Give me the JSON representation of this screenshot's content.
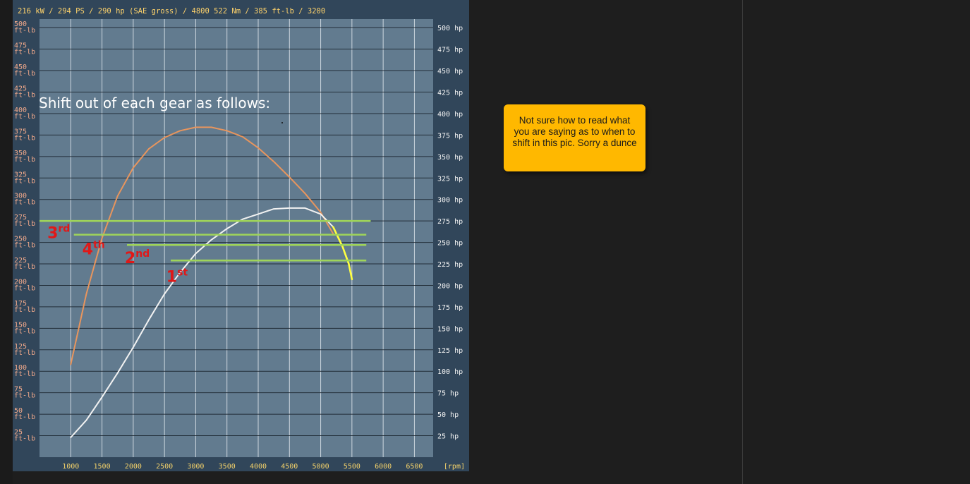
{
  "chart_data": {
    "type": "line",
    "title": "216 kW / 294 PS / 290 hp  (SAE gross) / 4800 522 Nm / 385 ft-lb / 3200",
    "xunit": "[rpm]",
    "x_ticks": [
      "1000",
      "1500",
      "2000",
      "2500",
      "3000",
      "3500",
      "4000",
      "4500",
      "5000",
      "5500",
      "6000",
      "6500"
    ],
    "xlim": [
      500,
      6800
    ],
    "ylim": [
      0,
      510
    ],
    "left_ticks": [
      {
        "v": 500,
        "a": "500",
        "b": "ft-lb"
      },
      {
        "v": 475,
        "a": "475",
        "b": "ft-lb"
      },
      {
        "v": 450,
        "a": "450",
        "b": "ft-lb"
      },
      {
        "v": 425,
        "a": "425",
        "b": "ft-lb"
      },
      {
        "v": 400,
        "a": "400",
        "b": "ft-lb"
      },
      {
        "v": 375,
        "a": "375",
        "b": "ft-lb"
      },
      {
        "v": 350,
        "a": "350",
        "b": "ft-lb"
      },
      {
        "v": 325,
        "a": "325",
        "b": "ft-lb"
      },
      {
        "v": 300,
        "a": "300",
        "b": "ft-lb"
      },
      {
        "v": 275,
        "a": "275",
        "b": "ft-lb"
      },
      {
        "v": 250,
        "a": "250",
        "b": "ft-lb"
      },
      {
        "v": 225,
        "a": "225",
        "b": "ft-lb"
      },
      {
        "v": 200,
        "a": "200",
        "b": "ft-lb"
      },
      {
        "v": 175,
        "a": "175",
        "b": "ft-lb"
      },
      {
        "v": 150,
        "a": "150",
        "b": "ft-lb"
      },
      {
        "v": 125,
        "a": "125",
        "b": "ft-lb"
      },
      {
        "v": 100,
        "a": "100",
        "b": "ft-lb"
      },
      {
        "v": 75,
        "a": "75",
        "b": "ft-lb"
      },
      {
        "v": 50,
        "a": "50",
        "b": "ft-lb"
      },
      {
        "v": 25,
        "a": "25",
        "b": "ft-lb"
      }
    ],
    "right_ticks": [
      {
        "v": 500,
        "t": "500 hp"
      },
      {
        "v": 475,
        "t": "475 hp"
      },
      {
        "v": 450,
        "t": "450 hp"
      },
      {
        "v": 425,
        "t": "425 hp"
      },
      {
        "v": 400,
        "t": "400 hp"
      },
      {
        "v": 375,
        "t": "375 hp"
      },
      {
        "v": 350,
        "t": "350 hp"
      },
      {
        "v": 325,
        "t": "325 hp"
      },
      {
        "v": 300,
        "t": "300 hp"
      },
      {
        "v": 275,
        "t": "275 hp"
      },
      {
        "v": 250,
        "t": "250 hp"
      },
      {
        "v": 225,
        "t": "225 hp"
      },
      {
        "v": 200,
        "t": "200 hp"
      },
      {
        "v": 175,
        "t": "175 hp"
      },
      {
        "v": 150,
        "t": "150 hp"
      },
      {
        "v": 125,
        "t": "125 hp"
      },
      {
        "v": 100,
        "t": "100 hp"
      },
      {
        "v": 75,
        "t": "75 hp"
      },
      {
        "v": 50,
        "t": "50 hp"
      },
      {
        "v": 25,
        "t": "25 hp"
      }
    ],
    "series": [
      {
        "color": "#e8955d",
        "points": [
          [
            1000,
            108
          ],
          [
            1250,
            190
          ],
          [
            1500,
            255
          ],
          [
            1750,
            304
          ],
          [
            2000,
            337
          ],
          [
            2250,
            359
          ],
          [
            2500,
            372
          ],
          [
            2750,
            380
          ],
          [
            3000,
            384
          ],
          [
            3250,
            384
          ],
          [
            3500,
            380
          ],
          [
            3750,
            373
          ],
          [
            4000,
            360
          ],
          [
            4250,
            344
          ],
          [
            4500,
            326
          ],
          [
            4750,
            307
          ],
          [
            5000,
            285
          ],
          [
            5200,
            260
          ]
        ]
      },
      {
        "color": "#f2f2f2",
        "points": [
          [
            1000,
            23
          ],
          [
            1250,
            43
          ],
          [
            1500,
            70
          ],
          [
            1750,
            98
          ],
          [
            2000,
            128
          ],
          [
            2250,
            160
          ],
          [
            2500,
            190
          ],
          [
            2750,
            215
          ],
          [
            3000,
            237
          ],
          [
            3250,
            253
          ],
          [
            3500,
            266
          ],
          [
            3750,
            277
          ],
          [
            4000,
            283
          ],
          [
            4250,
            289
          ],
          [
            4500,
            290
          ],
          [
            4750,
            290
          ],
          [
            5000,
            283
          ],
          [
            5200,
            268
          ]
        ]
      },
      {
        "color": "#ffff40",
        "points": [
          [
            5200,
            268
          ],
          [
            5350,
            245
          ],
          [
            5450,
            225
          ],
          [
            5500,
            207
          ]
        ]
      }
    ],
    "shift_lines": [
      {
        "from": 500,
        "to": 5800,
        "y": 275
      },
      {
        "from": 1050,
        "to": 5730,
        "y": 259
      },
      {
        "from": 1900,
        "to": 5730,
        "y": 247
      },
      {
        "from": 2600,
        "to": 5730,
        "y": 229
      }
    ],
    "annotation": "Shift out of each gear as follows:",
    "gear_labels": [
      {
        "main": "3",
        "sup": "rd",
        "rpm": 625,
        "val": 255
      },
      {
        "main": "4",
        "sup": "th",
        "rpm": 1185,
        "val": 236
      },
      {
        "main": "2",
        "sup": "nd",
        "rpm": 1865,
        "val": 226
      },
      {
        "main": "1",
        "sup": "st",
        "rpm": 2530,
        "val": 204
      }
    ]
  },
  "comment": {
    "text": "Not sure how to read what you are saying as to when to shift in this pic. Sorry a dunce"
  }
}
